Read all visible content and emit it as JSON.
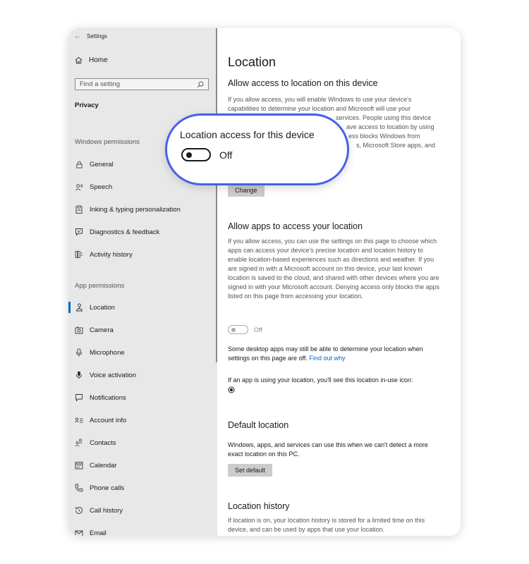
{
  "window": {
    "title": "Settings"
  },
  "sidebar": {
    "home": "Home",
    "search_placeholder": "Find a setting",
    "section": "Privacy",
    "windows_permissions_header": "Windows permissions",
    "windows_permissions": [
      {
        "label": "General",
        "icon": "lock-icon"
      },
      {
        "label": "Speech",
        "icon": "speech-icon"
      },
      {
        "label": "Inking & typing personalization",
        "icon": "clipboard-icon"
      },
      {
        "label": "Diagnostics & feedback",
        "icon": "feedback-icon"
      },
      {
        "label": "Activity history",
        "icon": "activity-icon"
      }
    ],
    "app_permissions_header": "App permissions",
    "app_permissions": [
      {
        "label": "Location",
        "icon": "location-icon",
        "active": true
      },
      {
        "label": "Camera",
        "icon": "camera-icon"
      },
      {
        "label": "Microphone",
        "icon": "microphone-icon"
      },
      {
        "label": "Voice activation",
        "icon": "voice-icon"
      },
      {
        "label": "Notifications",
        "icon": "notification-icon"
      },
      {
        "label": "Account info",
        "icon": "account-info-icon"
      },
      {
        "label": "Contacts",
        "icon": "contacts-icon"
      },
      {
        "label": "Calendar",
        "icon": "calendar-icon"
      },
      {
        "label": "Phone calls",
        "icon": "phone-icon"
      },
      {
        "label": "Call history",
        "icon": "history-icon"
      },
      {
        "label": "Email",
        "icon": "email-icon"
      }
    ]
  },
  "main": {
    "title": "Location",
    "allow_access": {
      "heading": "Allow access to location on this device",
      "body_lines": [
        "If you allow access, you will enable Windows to use your device's",
        "capabilities to determine your location and Microsoft will use your",
        "services. People using this device",
        "ave access to location by using",
        "ess blocks Windows from",
        "s, Microsoft Store apps, and"
      ],
      "change_button": "Change"
    },
    "allow_apps": {
      "heading": "Allow apps to access your location",
      "body": "If you allow access, you can use the settings on this page to choose which apps can access your device's precise location and location history to enable location-based experiences such as directions and weather. If you are signed in with a Microsoft account on this device, your last known location is saved to the cloud, and shared with other devices where you are signed in with your Microsoft account. Denying access only blocks the apps listed on this page from accessing your location.",
      "toggle_state": "Off",
      "desktop_note": "Some desktop apps may still be able to determine your location when settings on this page are off.",
      "find_out_why": "Find out why",
      "in_use_note": "If an app is using your location, you'll see this location in-use icon:"
    },
    "default_location": {
      "heading": "Default location",
      "body": "Windows, apps, and services can use this when we can't detect a more exact location on this PC.",
      "button": "Set default"
    },
    "history": {
      "heading": "Location history",
      "body": "If location is on, your location history is stored for a limited time on this device, and can be used by apps that use your location."
    }
  },
  "callout": {
    "title": "Location access for this device",
    "state": "Off"
  },
  "colors": {
    "accent": "#0067c0",
    "callout_border": "#4361ee",
    "sidebar_bg": "#e8e8e8"
  }
}
